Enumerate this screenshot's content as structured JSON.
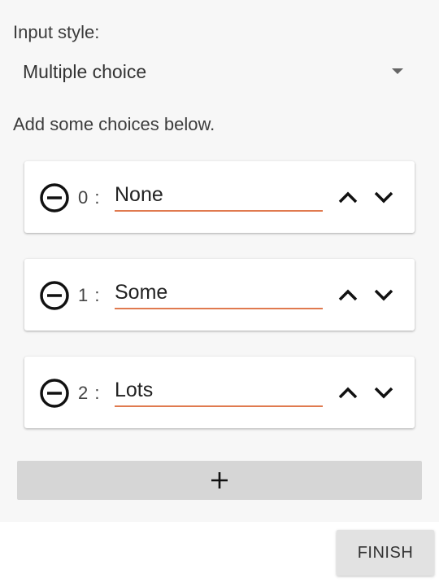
{
  "input_style": {
    "label": "Input style:",
    "selected_value": "Multiple choice"
  },
  "choices_hint": "Add some choices below.",
  "choices": [
    {
      "index_label": "0 :",
      "value": "None"
    },
    {
      "index_label": "1 :",
      "value": "Some"
    },
    {
      "index_label": "2 :",
      "value": "Lots"
    }
  ],
  "icons": {
    "remove": "minus-circle-icon",
    "move_up": "chevron-up-icon",
    "move_down": "chevron-down-icon",
    "add": "plus-icon",
    "dropdown": "dropdown-arrow-icon"
  },
  "colors": {
    "input_underline": "#e07a4f",
    "add_button_bg": "#d6d6d6",
    "finish_button_bg": "#e2e2e2"
  },
  "finish_button": {
    "label": "FINISH"
  }
}
